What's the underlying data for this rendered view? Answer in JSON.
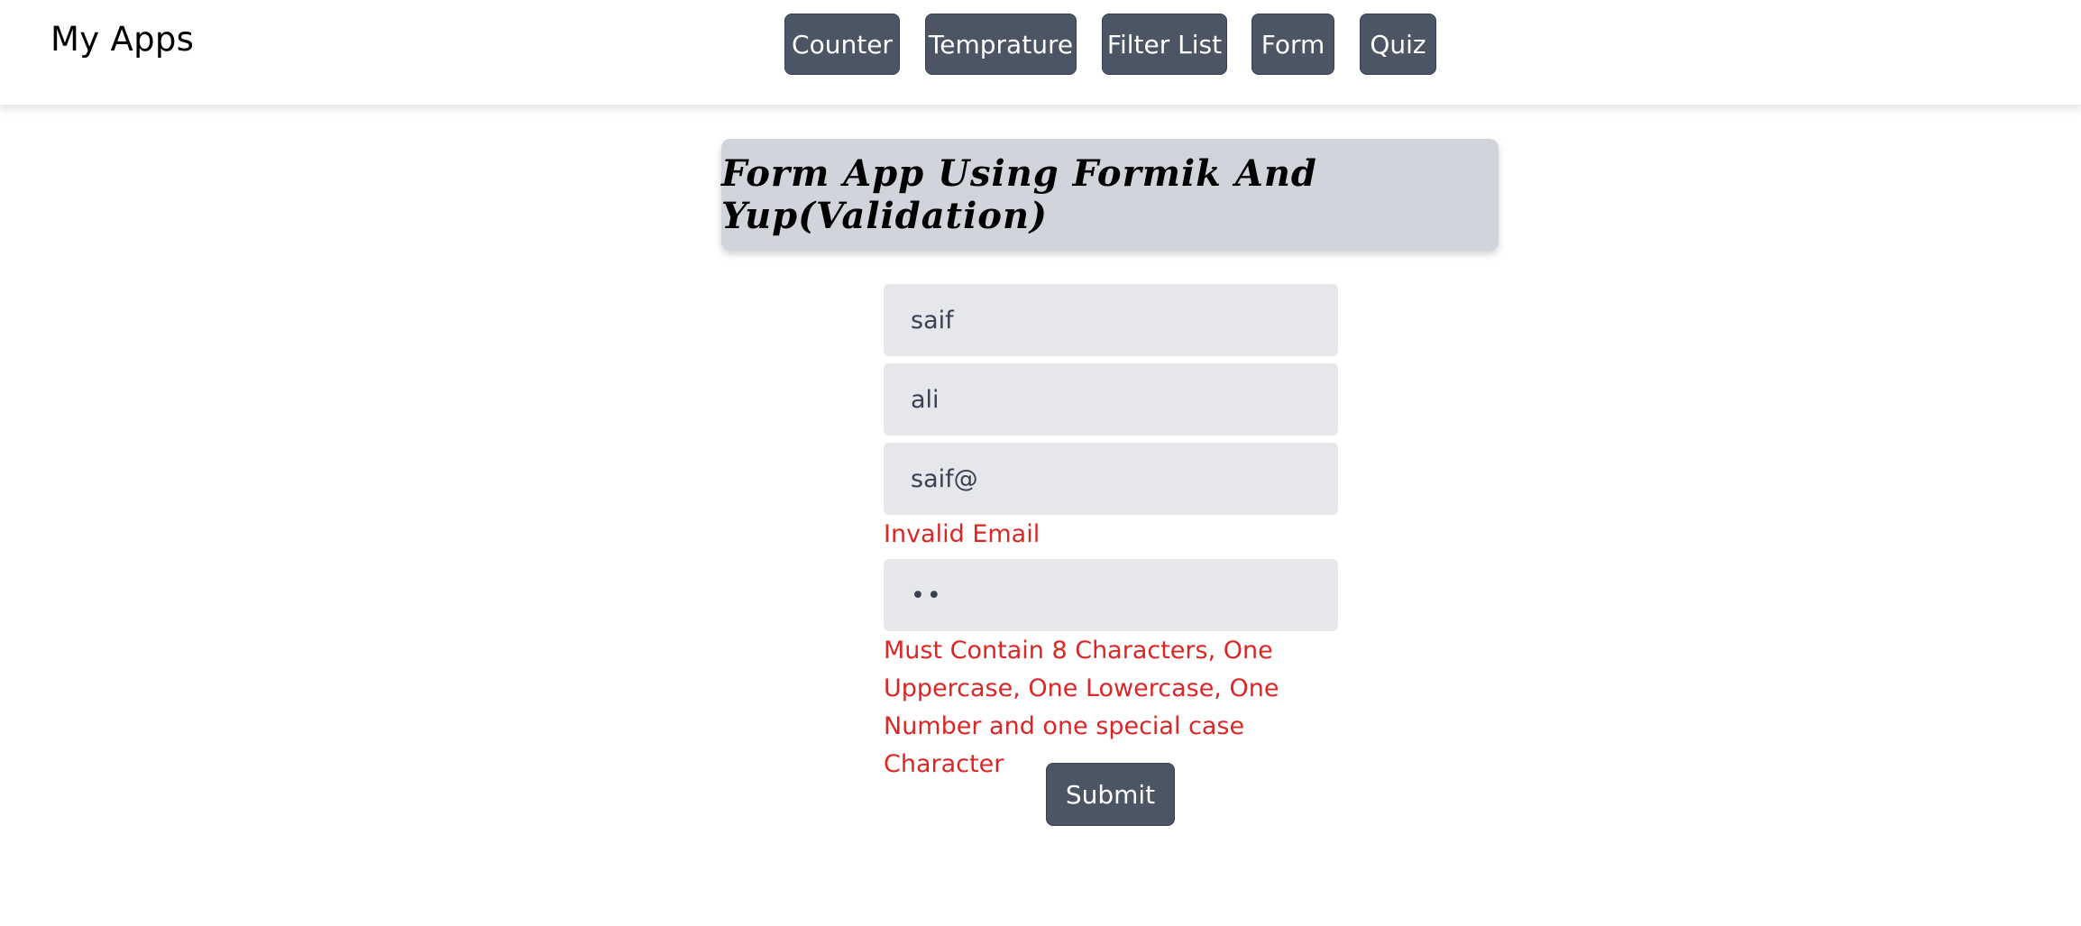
{
  "navbar": {
    "brand": "My Apps",
    "buttons": [
      "Counter",
      "Temprature",
      "Filter List",
      "Form",
      "Quiz"
    ]
  },
  "main": {
    "title": "Form App Using Formik And Yup(Validation)",
    "fields": {
      "first_name": "saif",
      "last_name": "ali",
      "email": "saif@",
      "password": "••"
    },
    "errors": {
      "email": "Invalid Email",
      "password": "Must Contain 8 Characters, One Uppercase, One Lowercase, One Number and one special case Character"
    },
    "submit_label": "Submit"
  },
  "colors": {
    "button_bg": "#4b5563",
    "field_bg": "#e5e7eb",
    "title_bg": "#d1d5db",
    "error_text": "#dc2626"
  }
}
